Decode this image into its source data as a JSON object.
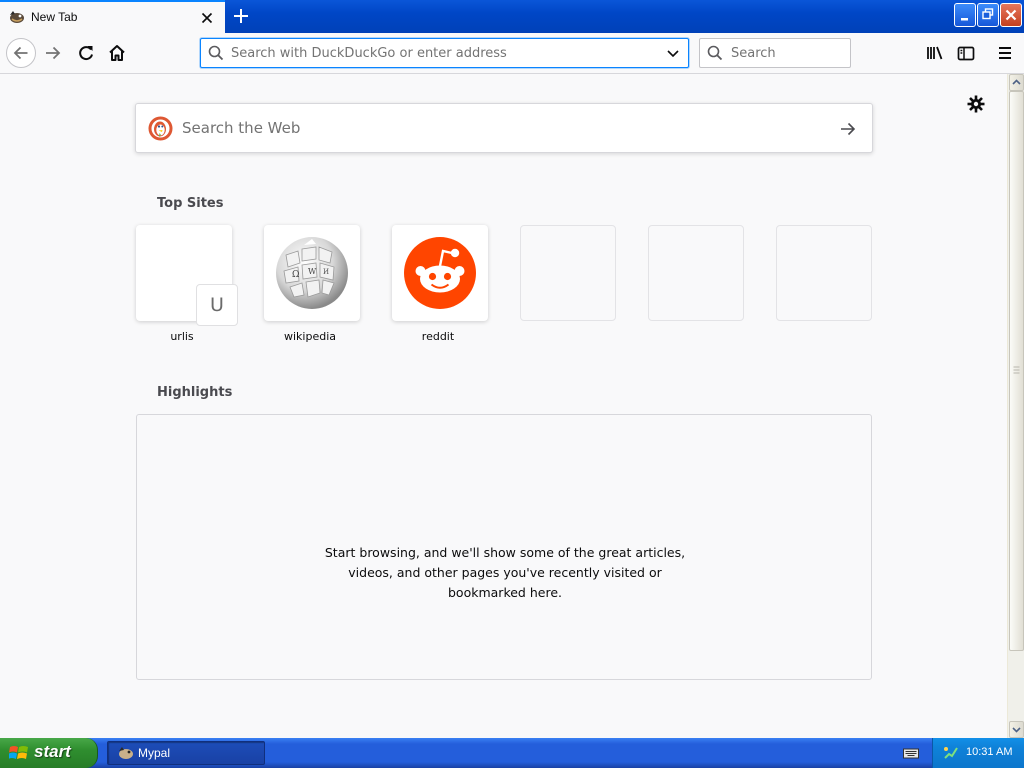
{
  "tab": {
    "title": "New Tab"
  },
  "toolbar": {
    "url_placeholder": "Search with DuckDuckGo or enter address",
    "search_placeholder": "Search"
  },
  "newtab": {
    "web_search_placeholder": "Search the Web",
    "top_sites_title": "Top Sites",
    "top_sites": [
      {
        "label": "urlis",
        "badge": "U"
      },
      {
        "label": "wikipedia"
      },
      {
        "label": "reddit"
      }
    ],
    "highlights_title": "Highlights",
    "highlights_empty": [
      "Start browsing, and we'll show some of the great articles,",
      "videos, and other pages you've recently visited or",
      "bookmarked here."
    ]
  },
  "taskbar": {
    "start_label": "start",
    "task_label": "Mypal",
    "clock": "10:31 AM"
  },
  "colors": {
    "accent": "#0a84ff",
    "reddit": "#ff4500",
    "xp_taskbar": "#245edb",
    "xp_start": "#2f8e2f"
  },
  "icons": [
    "mypal-icon",
    "close-icon",
    "plus-icon",
    "minimize-icon",
    "restore-icon",
    "back-arrow-icon",
    "forward-arrow-icon",
    "reload-icon",
    "home-icon",
    "search-icon",
    "chevron-down-icon",
    "library-icon",
    "sidebar-icon",
    "hamburger-menu-icon",
    "gear-icon",
    "duckduckgo-icon",
    "arrow-right-icon",
    "wikipedia-globe-icon",
    "reddit-icon",
    "windows-logo-icon",
    "keyboard-icon",
    "network-icon"
  ]
}
